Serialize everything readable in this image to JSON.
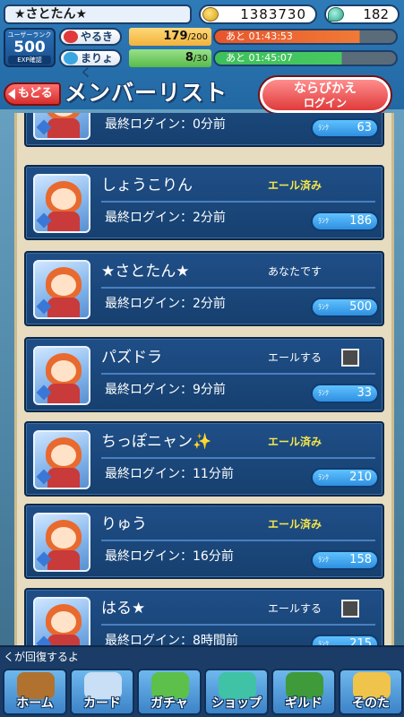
{
  "header": {
    "player_name": "★さとたん★",
    "coins": "1383730",
    "gems": "182",
    "rank_label": "ユーザーランク",
    "rank_value": "500",
    "exp_label": "EXP確認",
    "stamina_label": "やるき",
    "stamina_value": "179",
    "stamina_max": "/200",
    "stamina_timer": "あと 01:43:53",
    "magic_label": "まりょく",
    "magic_value": "8",
    "magic_max": "/30",
    "magic_timer": "あと 01:45:07"
  },
  "nav": {
    "back_label": "もどる",
    "title": "メンバーリスト",
    "sort_line1": "ならびかえ",
    "sort_line2": "ログイン"
  },
  "members": [
    {
      "name": "",
      "status": "",
      "login": "最終ログイン：0分前",
      "rank_tag": "ﾗﾝｸ",
      "rank": "63"
    },
    {
      "name": "しょうこりん",
      "status": "エール済み",
      "login": "最終ログイン：2分前",
      "rank_tag": "ﾗﾝｸ",
      "rank": "186"
    },
    {
      "name": "★さとたん★",
      "status": "あなたです",
      "login": "最終ログイン：2分前",
      "rank_tag": "ﾗﾝｸ",
      "rank": "500"
    },
    {
      "name": "パズドラ",
      "status": "エールする",
      "login": "最終ログイン：9分前",
      "rank_tag": "ﾗﾝｸ",
      "rank": "33"
    },
    {
      "name": "ちっぽニャン✨",
      "status": "エール済み",
      "login": "最終ログイン：11分前",
      "rank_tag": "ﾗﾝｸ",
      "rank": "210"
    },
    {
      "name": "りゅう",
      "status": "エール済み",
      "login": "最終ログイン：16分前",
      "rank_tag": "ﾗﾝｸ",
      "rank": "158"
    },
    {
      "name": "はる★",
      "status": "エールする",
      "login": "最終ログイン：8時間前",
      "rank_tag": "ﾗﾝｸ",
      "rank": "215"
    }
  ],
  "ticker": "くが回復するよ",
  "bottom_nav": [
    {
      "label": "ホーム",
      "icon": "home-icon",
      "color": "#b0722e"
    },
    {
      "label": "カード",
      "icon": "card-icon",
      "color": "#c9dff5"
    },
    {
      "label": "ガチャ",
      "icon": "gacha-icon",
      "color": "#5cc04a"
    },
    {
      "label": "ショップ",
      "icon": "shop-icon",
      "color": "#3fc2a6"
    },
    {
      "label": "ギルド",
      "icon": "guild-icon",
      "color": "#3f9a3a"
    },
    {
      "label": "そのた",
      "icon": "other-icon",
      "color": "#f0c44a"
    }
  ]
}
